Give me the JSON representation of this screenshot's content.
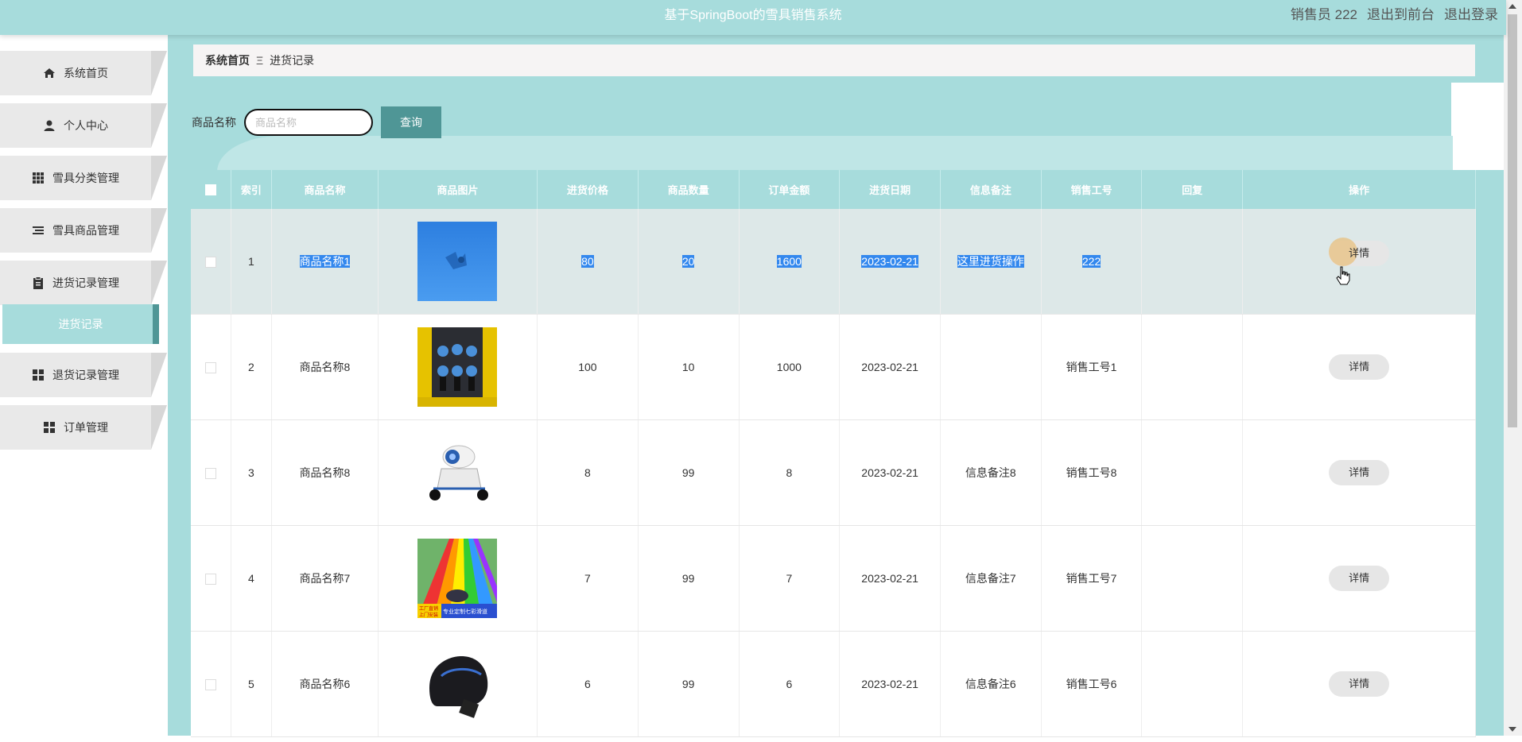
{
  "header": {
    "title": "基于SpringBoot的雪具销售系统",
    "user_label": "销售员 222",
    "exit_front": "退出到前台",
    "logout": "退出登录"
  },
  "sidebar": {
    "items": [
      {
        "label": "系统首页",
        "icon": "home-icon"
      },
      {
        "label": "个人中心",
        "icon": "user-icon"
      },
      {
        "label": "雪具分类管理",
        "icon": "grid-icon"
      },
      {
        "label": "雪具商品管理",
        "icon": "list-icon"
      },
      {
        "label": "进货记录管理",
        "icon": "clipboard-icon"
      },
      {
        "label": "进货记录",
        "icon": ""
      },
      {
        "label": "退货记录管理",
        "icon": "grid-icon"
      },
      {
        "label": "订单管理",
        "icon": "grid-icon"
      }
    ]
  },
  "breadcrumb": {
    "home": "系统首页",
    "separator": "Ξ",
    "current": "进货记录"
  },
  "search": {
    "label": "商品名称",
    "placeholder": "商品名称",
    "value": "",
    "button": "查询"
  },
  "table": {
    "headers": [
      "索引",
      "商品名称",
      "商品图片",
      "进货价格",
      "商品数量",
      "订单金额",
      "进货日期",
      "信息备注",
      "销售工号",
      "回复",
      "操作"
    ],
    "rows": [
      {
        "index": "1",
        "name": "商品名称1",
        "price": "80",
        "qty": "20",
        "amount": "1600",
        "date": "2023-02-21",
        "note": "这里进货操作",
        "staff": "222",
        "reply": "",
        "action": "详情"
      },
      {
        "index": "2",
        "name": "商品名称8",
        "price": "100",
        "qty": "10",
        "amount": "1000",
        "date": "2023-02-21",
        "note": "",
        "staff": "销售工号1",
        "reply": "",
        "action": "详情"
      },
      {
        "index": "3",
        "name": "商品名称8",
        "price": "8",
        "qty": "99",
        "amount": "8",
        "date": "2023-02-21",
        "note": "信息备注8",
        "staff": "销售工号8",
        "reply": "",
        "action": "详情"
      },
      {
        "index": "4",
        "name": "商品名称7",
        "price": "7",
        "qty": "99",
        "amount": "7",
        "date": "2023-02-21",
        "note": "信息备注7",
        "staff": "销售工号7",
        "reply": "",
        "action": "详情"
      },
      {
        "index": "5",
        "name": "商品名称6",
        "price": "6",
        "qty": "99",
        "amount": "6",
        "date": "2023-02-21",
        "note": "信息备注6",
        "staff": "销售工号6",
        "reply": "",
        "action": "详情"
      }
    ],
    "image_overlay_text": [
      "工厂直销",
      "上门安装",
      "专业定制七彩滑道"
    ]
  },
  "colors": {
    "theme": "#a7dcdc",
    "accent": "#4f9696",
    "selection": "#3388ee"
  }
}
